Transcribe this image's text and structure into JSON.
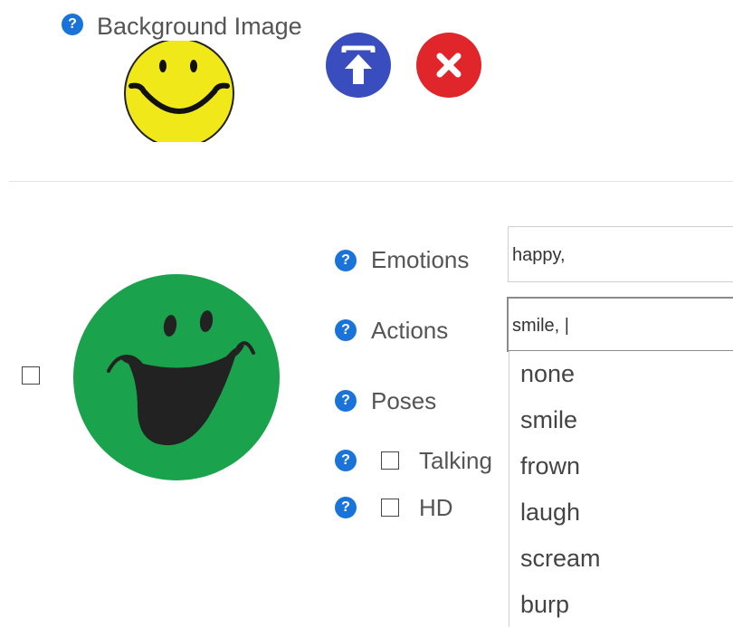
{
  "background": {
    "help_label": "?",
    "label": "Background Image",
    "upload_icon": "upload-icon",
    "remove_icon": "close-icon",
    "colors": {
      "upload": "#3a4dbf",
      "remove": "#e0262b",
      "smiley": "#f1e81a"
    }
  },
  "character": {
    "colors": {
      "face": "#1ba24c"
    },
    "emotions": {
      "help_label": "?",
      "label": "Emotions",
      "value": "happy,"
    },
    "actions": {
      "help_label": "?",
      "label": "Actions",
      "value": "smile, |",
      "options": [
        "none",
        "smile",
        "frown",
        "laugh",
        "scream",
        "burp"
      ]
    },
    "poses": {
      "help_label": "?",
      "label": "Poses"
    },
    "talking": {
      "help_label": "?",
      "label": "Talking"
    },
    "hd": {
      "help_label": "?",
      "label": "HD"
    }
  }
}
